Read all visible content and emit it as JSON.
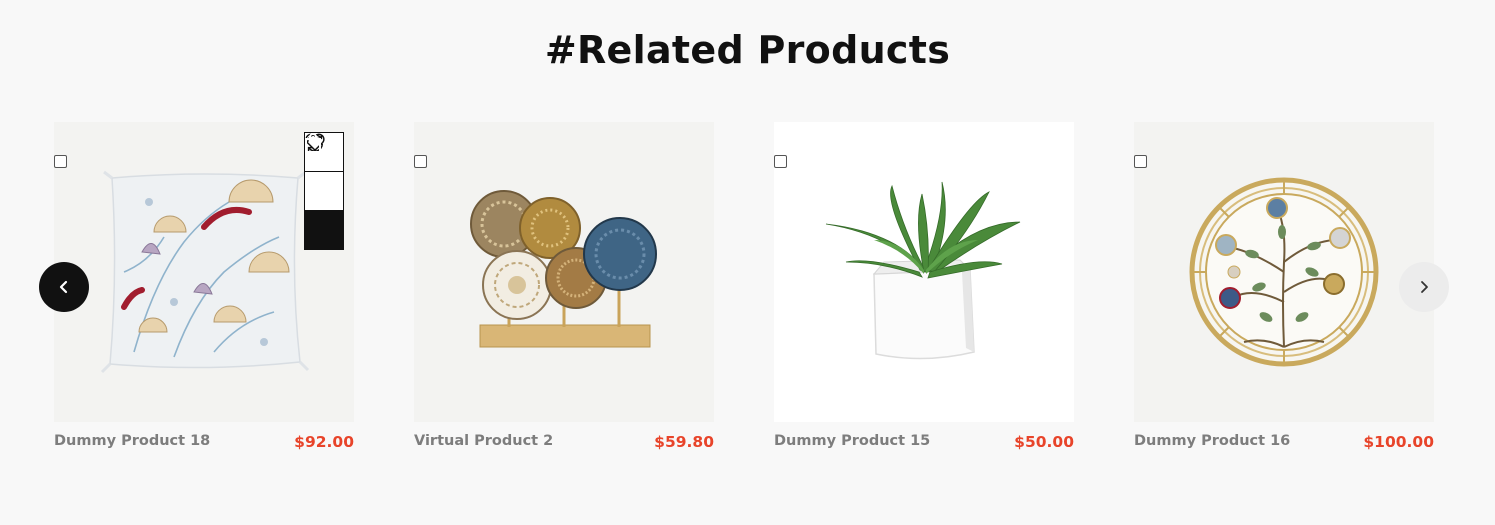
{
  "section": {
    "title": "#Related Products"
  },
  "carousel": {
    "prev_icon": "chevron-left-icon",
    "next_icon": "chevron-right-icon"
  },
  "card_actions": {
    "wishlist_icon": "heart-icon",
    "compare_icon": "refresh-icon",
    "cart_icon": "shopping-bag-icon"
  },
  "products": [
    {
      "name": "Dummy Product 18",
      "price": "$92.00",
      "image": "floral-cushion"
    },
    {
      "name": "Virtual Product 2",
      "price": "$59.80",
      "image": "decorative-plates-stand"
    },
    {
      "name": "Dummy Product 15",
      "price": "$50.00",
      "image": "potted-succulent"
    },
    {
      "name": "Dummy Product 16",
      "price": "$100.00",
      "image": "floral-wall-art"
    }
  ],
  "colors": {
    "background": "#f8f8f8",
    "price": "#e8442a",
    "name": "#7d7d7d",
    "title": "#111111"
  }
}
